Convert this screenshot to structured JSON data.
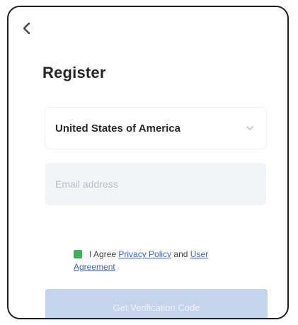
{
  "header": {
    "title": "Register"
  },
  "country": {
    "selected": "United States of America"
  },
  "email": {
    "value": "",
    "placeholder": "Email address"
  },
  "agreement": {
    "prefix": "I Agree",
    "privacy_link": "Privacy Policy",
    "and": "and",
    "user_agreement_link": "User Agreement"
  },
  "submit": {
    "label": "Get Verification Code"
  },
  "colors": {
    "checkbox": "#3fb05a",
    "link": "#3a67c9",
    "button_disabled": "#c5d4ea"
  }
}
